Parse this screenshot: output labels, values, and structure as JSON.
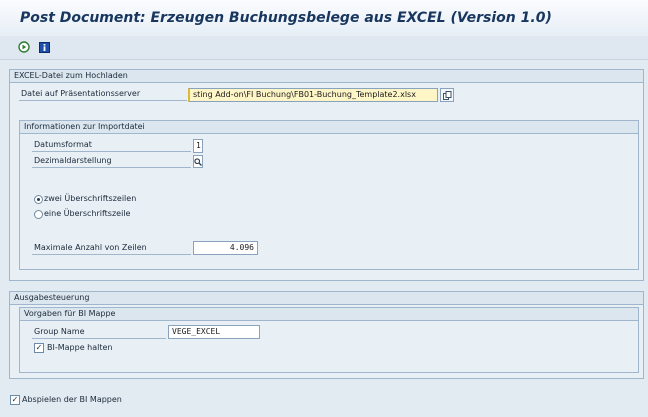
{
  "window": {
    "title": "Post Document: Erzeugen Buchungsbelege aus EXCEL (Version 1.0)"
  },
  "toolbar": {
    "icons": [
      "execute-icon",
      "information-icon"
    ]
  },
  "upload": {
    "header": "EXCEL-Datei zum Hochladen",
    "file_label": "Datei auf Präsentationsserver",
    "file_value": "sting Add-on\\FI Buchung\\FB01-Buchung_Template2.xlsx"
  },
  "import_info": {
    "header": "Informationen zur Importdatei",
    "date_format_label": "Datumsformat",
    "date_format_value": "1",
    "decimal_label": "Dezimaldarstellung",
    "radio_two": "zwei Überschriftszeilen",
    "radio_one": "eine Überschriftszeile",
    "radio_selected": "zwei Überschriftszeilen",
    "max_rows_label": "Maximale Anzahl von Zeilen",
    "max_rows_value": "4.096"
  },
  "output": {
    "header": "Ausgabesteuerung",
    "bi_header": "Vorgaben für BI Mappe",
    "group_name_label": "Group Name",
    "group_name_value": "VEGE_EXCEL",
    "keep_label": "BI-Mappe halten",
    "keep_checked": true,
    "play_label": "Abspielen der BI Mappen",
    "play_checked": true
  },
  "colors": {
    "title": "#18365e",
    "background": "#e3ebf2",
    "required_field": "#fff6c8"
  }
}
